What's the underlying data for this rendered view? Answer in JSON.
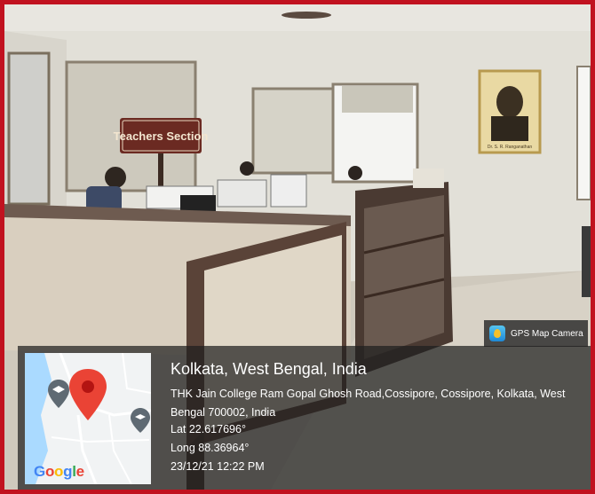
{
  "photo": {
    "sign_text": "Teachers Section",
    "portrait_caption": "Dr. S. R. Ranganathan"
  },
  "camera_badge": {
    "label": "GPS Map Camera",
    "icon": "gps-map-camera-icon"
  },
  "location": {
    "place": "Kolkata, West Bengal, India",
    "address": "THK Jain College Ram Gopal Ghosh Road,Cossipore, Cossipore, Kolkata, West Bengal 700002, India",
    "latitude": "Lat 22.617696°",
    "longitude": "Long 88.36964°",
    "timestamp": "23/12/21 12:22 PM"
  },
  "map": {
    "logo_parts": [
      "G",
      "o",
      "o",
      "g",
      "l",
      "e"
    ],
    "pin_icon": "map-pin-icon",
    "poi_icon": "school-icon"
  },
  "colors": {
    "border": "#c1121f",
    "pin": "#ea4335",
    "overlay": "#1e1e1e"
  }
}
